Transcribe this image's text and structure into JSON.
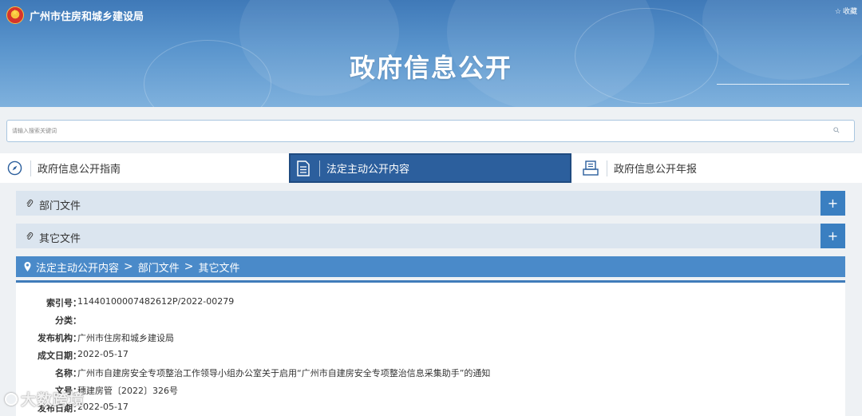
{
  "header": {
    "org_name": "广州市住房和城乡建设局",
    "favorite_label": "收藏",
    "page_title": "政府信息公开"
  },
  "search": {
    "placeholder": "请输入搜索关键词"
  },
  "tabs": [
    {
      "label": "政府信息公开指南",
      "icon": "compass-icon",
      "active": false
    },
    {
      "label": "法定主动公开内容",
      "icon": "document-icon",
      "active": true
    },
    {
      "label": "政府信息公开年报",
      "icon": "report-icon",
      "active": false
    }
  ],
  "accordion": [
    {
      "label": "部门文件",
      "toggle": "+"
    },
    {
      "label": "其它文件",
      "toggle": "+"
    }
  ],
  "breadcrumb": {
    "items": [
      "法定主动公开内容",
      "部门文件",
      "其它文件"
    ],
    "separator": ">"
  },
  "details": [
    {
      "key": "索引号：",
      "value": "11440100007482612P/2022-00279"
    },
    {
      "key": "分类：",
      "value": ""
    },
    {
      "key": "发布机构：",
      "value": "广州市住房和城乡建设局"
    },
    {
      "key": "成文日期：",
      "value": "2022-05-17"
    },
    {
      "key": "名称：",
      "value": "广州市自建房安全专项整治工作领导小组办公室关于启用“广州市自建房安全专项整治信息采集助手”的通知"
    },
    {
      "key": "文号：",
      "value": "穗建房管〔2022〕326号"
    },
    {
      "key": "发布日期：",
      "value": "2022-05-17"
    }
  ],
  "watermark": "大数跨境",
  "colors": {
    "banner": "#4a86c2",
    "active_tab": "#2c5f9d",
    "accordion_bg": "#dbe5ef",
    "plus_button": "#3a7fc1",
    "breadcrumb": "#4a8ac9"
  }
}
